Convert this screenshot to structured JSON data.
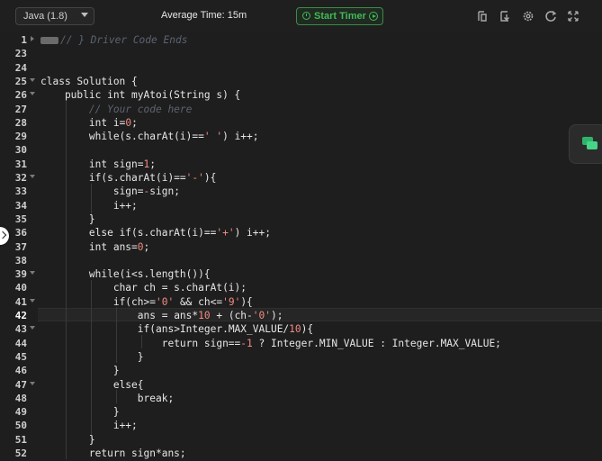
{
  "toolbar": {
    "language": "Java (1.8)",
    "average_time": "Average Time: 15m",
    "timer_label": "Start Timer",
    "icons": [
      "layout-icon",
      "download-icon",
      "settings-icon",
      "reset-icon",
      "fullscreen-icon"
    ]
  },
  "editor": {
    "active_line": "42",
    "lines": [
      {
        "n": "1",
        "fold": "closed"
      },
      {
        "n": "23"
      },
      {
        "n": "24"
      },
      {
        "n": "25",
        "fold": "open"
      },
      {
        "n": "26",
        "fold": "open"
      },
      {
        "n": "27"
      },
      {
        "n": "28"
      },
      {
        "n": "29"
      },
      {
        "n": "30"
      },
      {
        "n": "31"
      },
      {
        "n": "32",
        "fold": "open"
      },
      {
        "n": "33"
      },
      {
        "n": "34"
      },
      {
        "n": "35"
      },
      {
        "n": "36"
      },
      {
        "n": "37"
      },
      {
        "n": "38"
      },
      {
        "n": "39",
        "fold": "open"
      },
      {
        "n": "40"
      },
      {
        "n": "41",
        "fold": "open"
      },
      {
        "n": "42"
      },
      {
        "n": "43",
        "fold": "open"
      },
      {
        "n": "44"
      },
      {
        "n": "45"
      },
      {
        "n": "46"
      },
      {
        "n": "47",
        "fold": "open"
      },
      {
        "n": "48"
      },
      {
        "n": "49"
      },
      {
        "n": "50"
      },
      {
        "n": "51"
      },
      {
        "n": "52"
      }
    ],
    "code": {
      "l1_comment": "// } Driver Code Ends",
      "l25": "class Solution {",
      "l26": "    public int myAtoi(String s) {",
      "l27_comment": "// Your code here",
      "l28_a": "int i=",
      "l28_b": "0",
      "l28_c": ";",
      "l29_a": "while(s.charAt(i)==",
      "l29_b": "' '",
      "l29_c": ") i++;",
      "l31_a": "int sign=",
      "l31_b": "1",
      "l31_c": ";",
      "l32_a": "if(s.charAt(i)==",
      "l32_b": "'-'",
      "l32_c": "){",
      "l33_a": "sign=",
      "l33_b": "-",
      "l33_c": "sign;",
      "l34": "i++;",
      "l35": "}",
      "l36_a": "else if(s.charAt(i)==",
      "l36_b": "'+'",
      "l36_c": ") i++;",
      "l37_a": "int ans=",
      "l37_b": "0",
      "l37_c": ";",
      "l39": "while(i<s.length()){",
      "l40": "char ch = s.charAt(i);",
      "l41_a": "if(ch>=",
      "l41_b": "'0'",
      "l41_c": " && ch<=",
      "l41_d": "'9'",
      "l41_e": "){",
      "l42_a": "ans = ans*",
      "l42_b": "10",
      "l42_c": " + (ch-",
      "l42_d": "'0'",
      "l42_e": ");",
      "l43_a": "if(ans>Integer.MAX_VALUE/",
      "l43_b": "10",
      "l43_c": "){",
      "l44_a": "return sign==",
      "l44_b": "-1",
      "l44_c": " ? Integer.MIN_VALUE : Integer.MAX_VALUE;",
      "l45": "}",
      "l46": "}",
      "l47": "else{",
      "l48": "break;",
      "l49": "}",
      "l50": "i++;",
      "l51": "}",
      "l52": "return sign*ans;"
    }
  }
}
